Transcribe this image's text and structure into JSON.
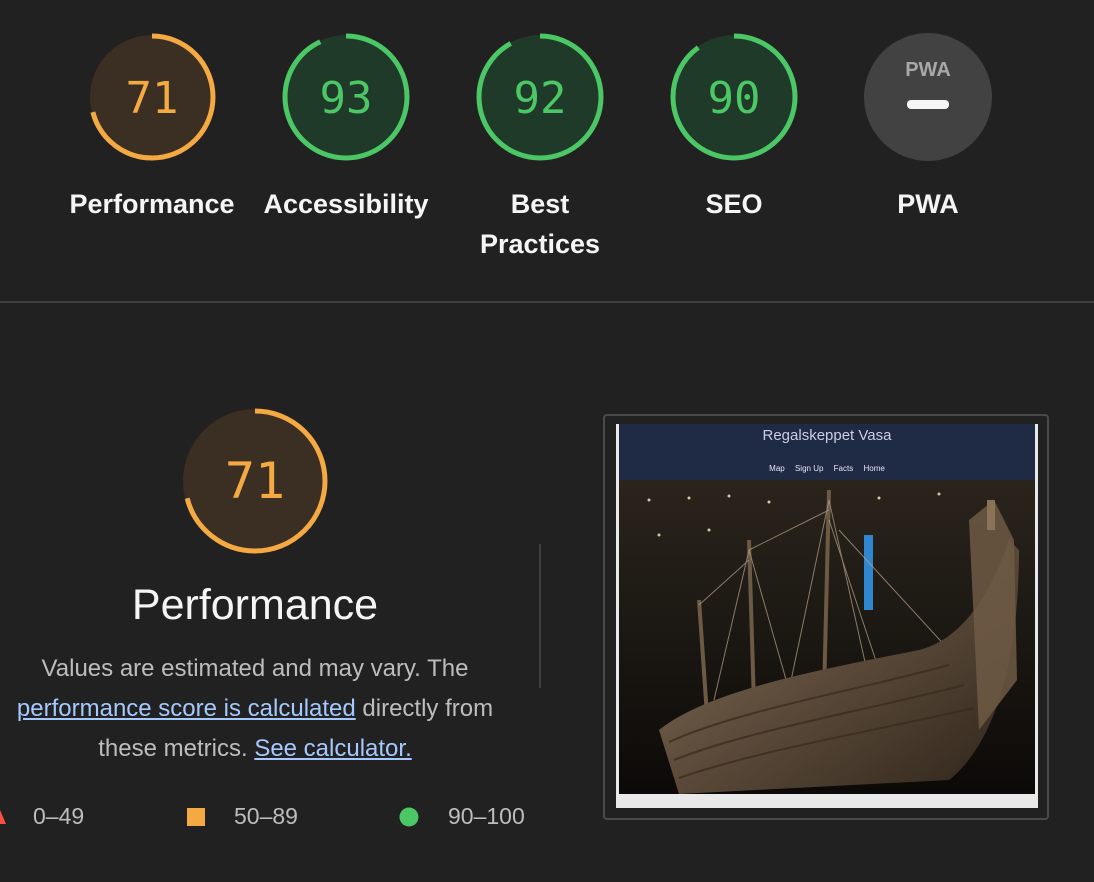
{
  "scores": [
    {
      "label": "Performance",
      "value": "71",
      "color": "#f4a942"
    },
    {
      "label": "Accessibility",
      "value": "93",
      "color": "#4cc765"
    },
    {
      "label": "Best Practices",
      "value": "92",
      "color": "#4cc765"
    },
    {
      "label": "SEO",
      "value": "90",
      "color": "#4cc765"
    },
    {
      "label": "PWA",
      "value": "PWA",
      "color": "#a8a8a8"
    }
  ],
  "performance": {
    "score": "71",
    "title": "Performance",
    "desc_line1": "Values are estimated and may vary. The",
    "link1": "performance score is calculated",
    "desc_line2_tail": "directly from",
    "desc_line3": "these metrics.",
    "link2": "See calculator."
  },
  "legend": [
    {
      "range": "0–49",
      "shape": "triangle",
      "color": "#ff4e42"
    },
    {
      "range": "50–89",
      "shape": "square",
      "color": "#f4a942"
    },
    {
      "range": "90–100",
      "shape": "circle",
      "color": "#4cc765"
    }
  ],
  "screenshot": {
    "site_title": "Regalskeppet Vasa",
    "nav": [
      "Map",
      "Sign Up",
      "Facts",
      "Home"
    ]
  }
}
